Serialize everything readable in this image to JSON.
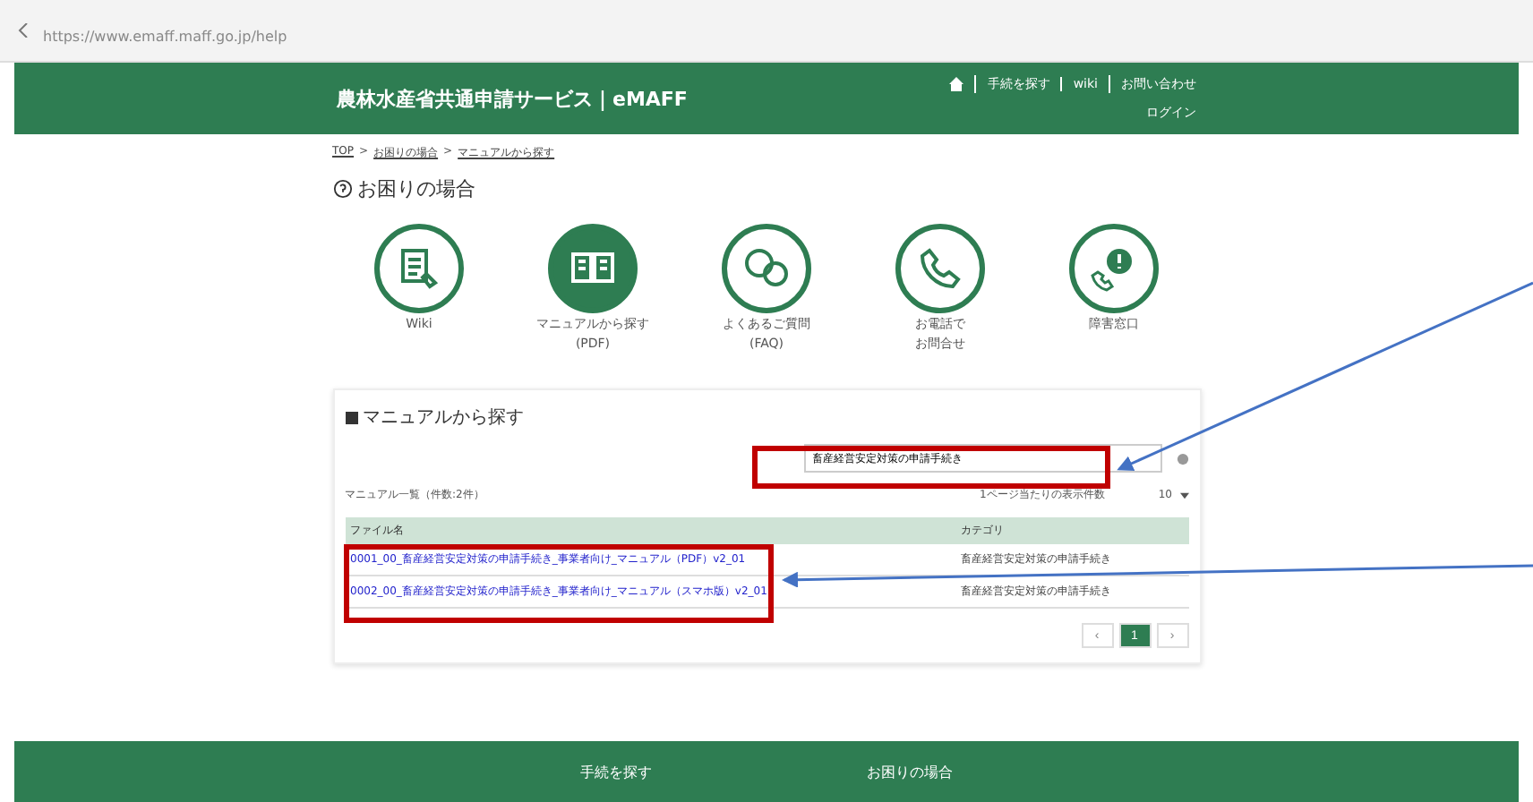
{
  "browser": {
    "address": "https://www.emaff.maff.go.jp/help"
  },
  "header": {
    "title": "農林水産省共通申請サービス｜eMAFF",
    "links": [
      "手続を探す",
      "wiki",
      "お問い合わせ"
    ],
    "login": "ログイン"
  },
  "breadcrumb": [
    {
      "label": "TOP"
    },
    {
      "separator": ">",
      "label": "お困りの場合"
    },
    {
      "separator": ">",
      "label": "マニュアルから探す"
    }
  ],
  "page_title": "お困りの場合",
  "help_options": [
    {
      "kind": "wiki",
      "label": "Wiki",
      "selected": false
    },
    {
      "kind": "manual",
      "label": "マニュアルから探す",
      "label_2": "(PDF)",
      "selected": true
    },
    {
      "kind": "faq",
      "label": "よくあるご質問",
      "label_2": "(FAQ)",
      "selected": false
    },
    {
      "kind": "phone",
      "label": "お電話で",
      "label_2": "お問合せ",
      "selected": false
    },
    {
      "kind": "trouble",
      "label": "障害窓口",
      "selected": false
    }
  ],
  "section_title": "マニュアルから探す",
  "search": {
    "value": "畜産経営安定対策の申請手続き"
  },
  "list_summary": "マニュアル一覧（件数:2件）",
  "page_size_label": "1ページ当たりの表示件数",
  "page_size": "10",
  "table": {
    "columns": [
      "ファイル名",
      "カテゴリ"
    ],
    "rows": [
      [
        "0001_00_畜産経営安定対策の申請手続き_事業者向け_マニュアル（PDF）v2_01",
        "畜産経営安定対策の申請手続き"
      ],
      [
        "0002_00_畜産経営安定対策の申請手続き_事業者向け_マニュアル（スマホ版）v2_01",
        "畜産経営安定対策の申請手続き"
      ]
    ]
  },
  "pagination": [
    {
      "label": "‹",
      "selected": false
    },
    {
      "label": "1",
      "selected": true
    },
    {
      "label": "›",
      "selected": false
    }
  ],
  "footer": [
    "手続を探す",
    "お困りの場合"
  ]
}
